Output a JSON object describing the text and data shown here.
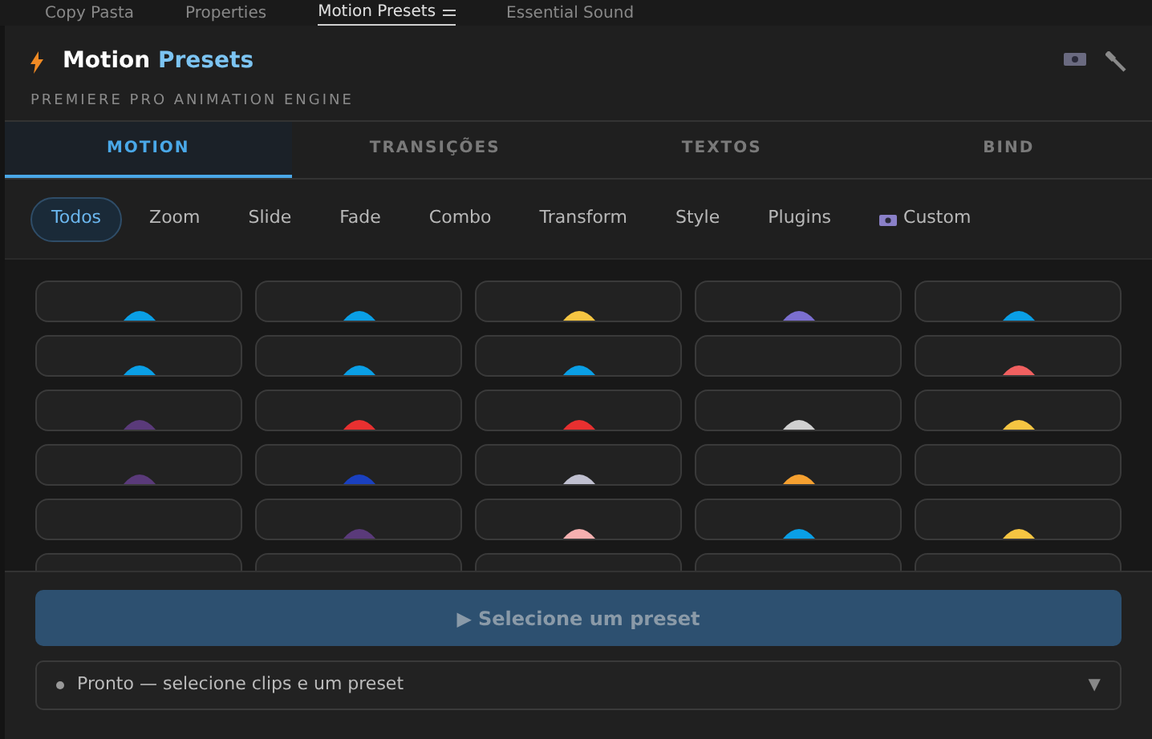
{
  "panel_tabs": [
    {
      "label": "Copy Pasta",
      "selected": false
    },
    {
      "label": "Properties",
      "selected": false
    },
    {
      "label": "Motion Presets",
      "selected": true
    },
    {
      "label": "Essential Sound",
      "selected": false
    }
  ],
  "header": {
    "title": "Motion",
    "title_accent": "Presets",
    "subtitle": "PREMIERE PRO ANIMATION ENGINE"
  },
  "tabs": [
    {
      "label": "MOTION",
      "selected": true
    },
    {
      "label": "TRANSIÇÕES",
      "selected": false
    },
    {
      "label": "TEXTOS",
      "selected": false
    },
    {
      "label": "BIND",
      "selected": false
    }
  ],
  "filters": [
    {
      "label": "Todos",
      "selected": true,
      "icon": false
    },
    {
      "label": "Zoom",
      "selected": false,
      "icon": false
    },
    {
      "label": "Slide",
      "selected": false,
      "icon": false
    },
    {
      "label": "Fade",
      "selected": false,
      "icon": false
    },
    {
      "label": "Combo",
      "selected": false,
      "icon": false
    },
    {
      "label": "Transform",
      "selected": false,
      "icon": false
    },
    {
      "label": "Style",
      "selected": false,
      "icon": false
    },
    {
      "label": "Plugins",
      "selected": false,
      "icon": false
    },
    {
      "label": "Custom",
      "selected": false,
      "icon": true
    }
  ],
  "presets": [
    {
      "kind": "sprite",
      "color": "#0a9fe6"
    },
    {
      "kind": "sprite",
      "color": "#0a9fe6"
    },
    {
      "kind": "sprite",
      "color": "#f5c542"
    },
    {
      "kind": "sprite",
      "color": "#7b6fd0"
    },
    {
      "kind": "sprite",
      "color": "#0a9fe6"
    },
    {
      "kind": "sprite",
      "color": "#0a9fe6"
    },
    {
      "kind": "sprite",
      "color": "#0a9fe6"
    },
    {
      "kind": "sprite",
      "color": "#0a9fe6"
    },
    {
      "kind": "blank"
    },
    {
      "kind": "sprite",
      "color": "#f06060"
    },
    {
      "kind": "sprite",
      "color": "#5a3a7a"
    },
    {
      "kind": "sprite",
      "color": "#e83030"
    },
    {
      "kind": "sprite",
      "color": "#e83030"
    },
    {
      "kind": "sprite",
      "color": "#d0d0d0"
    },
    {
      "kind": "sprite",
      "color": "#f5c542"
    },
    {
      "kind": "sprite",
      "color": "#5a3a7a"
    },
    {
      "kind": "sprite",
      "color": "#1a40c0"
    },
    {
      "kind": "sprite",
      "color": "#c0c0d0"
    },
    {
      "kind": "sprite",
      "color": "#f5a030"
    },
    {
      "kind": "blank"
    },
    {
      "kind": "blank"
    },
    {
      "kind": "sprite",
      "color": "#5a3a7a"
    },
    {
      "kind": "sprite",
      "color": "#f5b0b0"
    },
    {
      "kind": "sprite",
      "color": "#0a9fe6"
    },
    {
      "kind": "sprite",
      "color": "#f5c542"
    },
    {
      "kind": "blank"
    },
    {
      "kind": "blank"
    },
    {
      "kind": "blank"
    },
    {
      "kind": "blank"
    },
    {
      "kind": "blank"
    }
  ],
  "apply_button": {
    "icon": "▶",
    "label": "Selecione um preset",
    "disabled": true
  },
  "status": {
    "text": "Pronto — selecione clips e um preset",
    "caret": "▼"
  }
}
